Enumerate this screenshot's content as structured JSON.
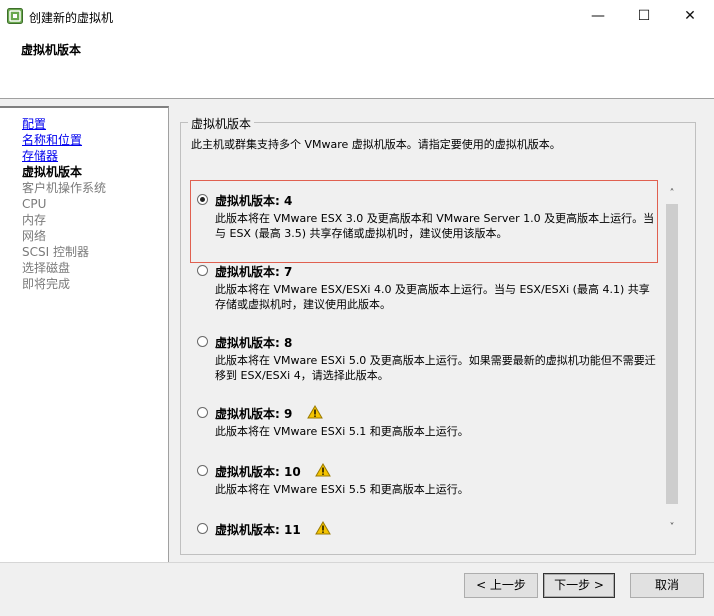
{
  "window": {
    "title": "创建新的虚拟机",
    "min_glyph": "—",
    "max_glyph": "☐",
    "close_glyph": "✕"
  },
  "header": {
    "title": "虚拟机版本"
  },
  "nav": {
    "items": [
      {
        "label": "配置",
        "state": "link"
      },
      {
        "label": "名称和位置",
        "state": "link"
      },
      {
        "label": "存储器",
        "state": "link"
      },
      {
        "label": "虚拟机版本",
        "state": "current"
      },
      {
        "label": "客户机操作系统",
        "state": "disabled"
      },
      {
        "label": "CPU",
        "state": "disabled"
      },
      {
        "label": "内存",
        "state": "disabled"
      },
      {
        "label": "网络",
        "state": "disabled"
      },
      {
        "label": "SCSI 控制器",
        "state": "disabled"
      },
      {
        "label": "选择磁盘",
        "state": "disabled"
      },
      {
        "label": "即将完成",
        "state": "disabled"
      }
    ]
  },
  "main": {
    "group_title": "虚拟机版本",
    "description": "此主机或群集支持多个 VMware 虚拟机版本。请指定要使用的虚拟机版本。",
    "options": [
      {
        "label": "虚拟机版本: 4",
        "checked": true,
        "warning": false,
        "desc": "此版本将在 VMware ESX 3.0 及更高版本和 VMware Server 1.0 及更高版本上运行。当与 ESX (最高 3.5) 共享存储或虚拟机时，建议使用该版本。"
      },
      {
        "label": "虚拟机版本: 7",
        "checked": false,
        "warning": false,
        "desc": "此版本将在 VMware ESX/ESXi 4.0 及更高版本上运行。当与 ESX/ESXi (最高 4.1) 共享存储或虚拟机时，建议使用此版本。"
      },
      {
        "label": "虚拟机版本: 8",
        "checked": false,
        "warning": false,
        "desc": "此版本将在 VMware ESXi 5.0 及更高版本上运行。如果需要最新的虚拟机功能但不需要迁移到 ESX/ESXi 4，请选择此版本。"
      },
      {
        "label": "虚拟机版本: 9",
        "checked": false,
        "warning": true,
        "desc": "此版本将在 VMware ESXi 5.1 和更高版本上运行。"
      },
      {
        "label": "虚拟机版本: 10",
        "checked": false,
        "warning": true,
        "desc": "此版本将在 VMware ESXi 5.5 和更高版本上运行。"
      },
      {
        "label": "虚拟机版本: 11",
        "checked": false,
        "warning": true,
        "desc": ""
      }
    ]
  },
  "scrollbar": {
    "up_glyph": "˄",
    "down_glyph": "˅"
  },
  "footer": {
    "back_label": "< 上一步",
    "next_label": "下一步 >",
    "cancel_label": "取消"
  },
  "colors": {
    "link": "#0000ee",
    "highlight_border": "#e06050",
    "warning": "#f5c400"
  }
}
